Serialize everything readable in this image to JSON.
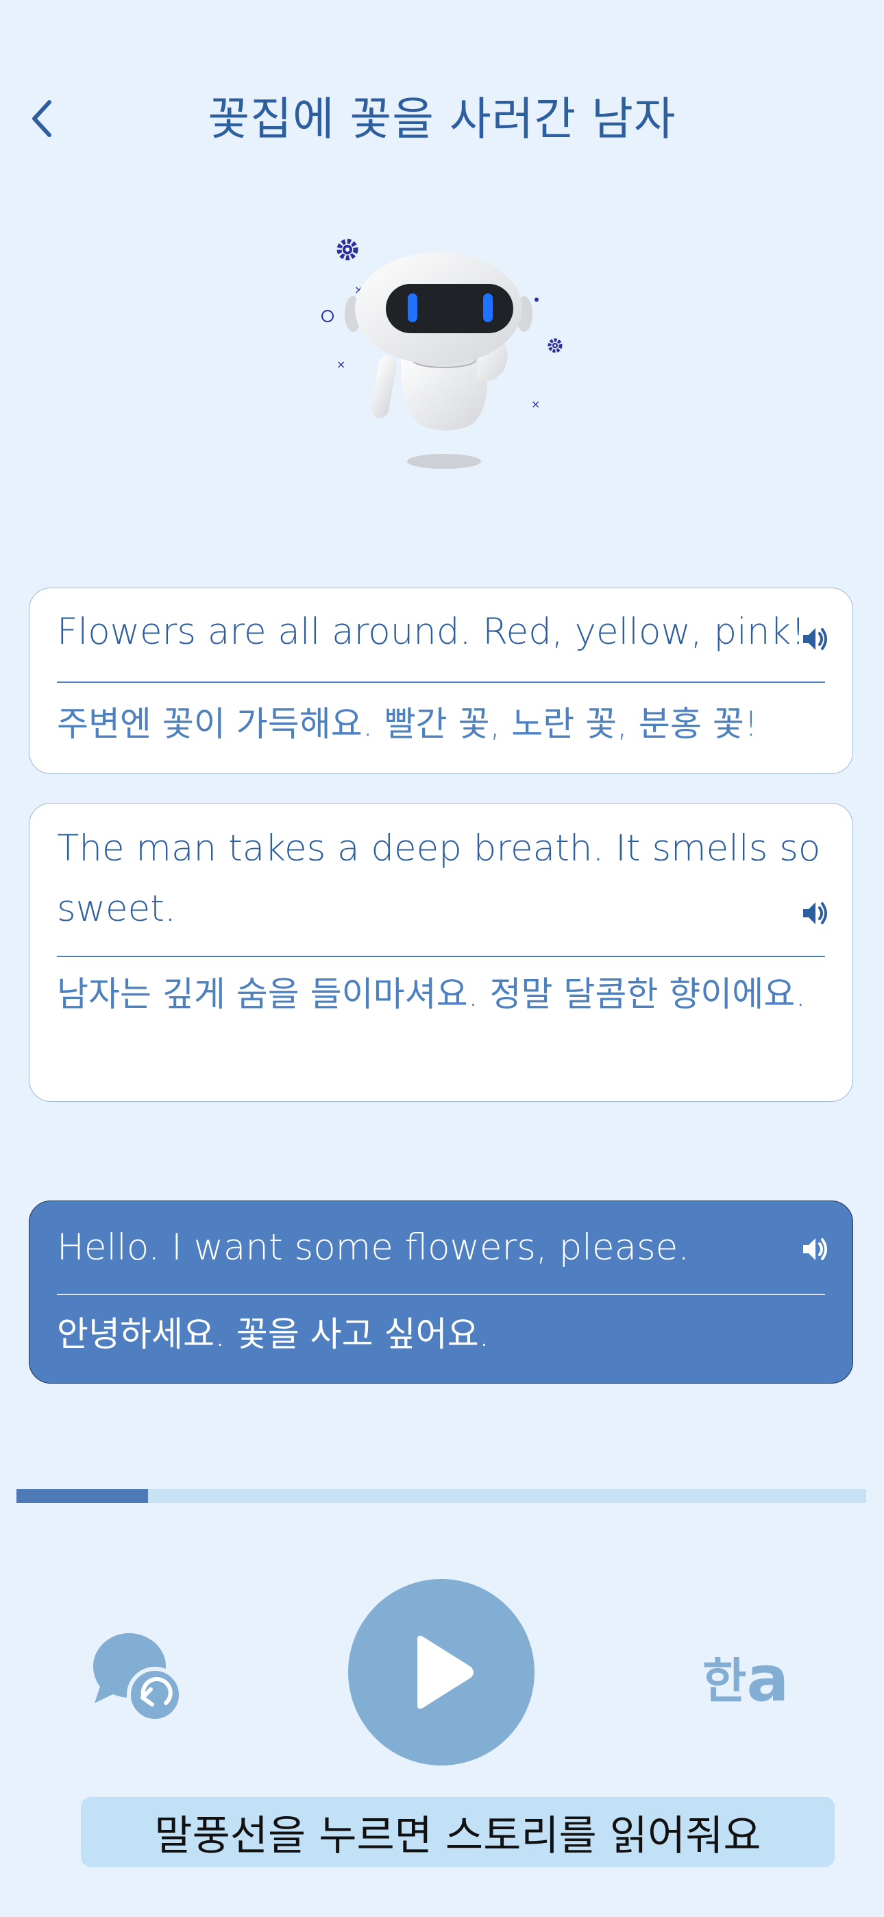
{
  "header": {
    "title": "꽃집에 꽃을 사러간 남자"
  },
  "cards": [
    {
      "en": "Flowers are all around. Red, yellow, pink!",
      "ko": "주변엔 꽃이 가득해요. 빨간 꽃, 노란 꽃, 분홍 꽃!",
      "active": false
    },
    {
      "en": "The man takes a deep breath. It smells so sweet.",
      "ko": "남자는 깊게 숨을 들이마셔요. 정말 달콤한 향이에요.",
      "active": false
    },
    {
      "en": "Hello. I want some flowers, please.",
      "ko": "안녕하세요. 꽃을 사고 싶어요.",
      "active": true
    }
  ],
  "progress": {
    "fraction": 0.155
  },
  "controls": {
    "lang_toggle_ko": "한",
    "lang_toggle_en": "a"
  },
  "hint": "말풍선을 누르면 스토리를 읽어줘요",
  "colors": {
    "background": "#e8f2fc",
    "primary": "#2d5f9e",
    "accent": "#4f7fc0",
    "play_button": "#83aed3",
    "progress_track": "#c7e0f2",
    "hint_background": "#c2e0f6"
  },
  "icons": {
    "back": "chevron-left-icon",
    "speaker": "speaker-icon",
    "replay": "chat-replay-icon",
    "play": "play-icon"
  }
}
